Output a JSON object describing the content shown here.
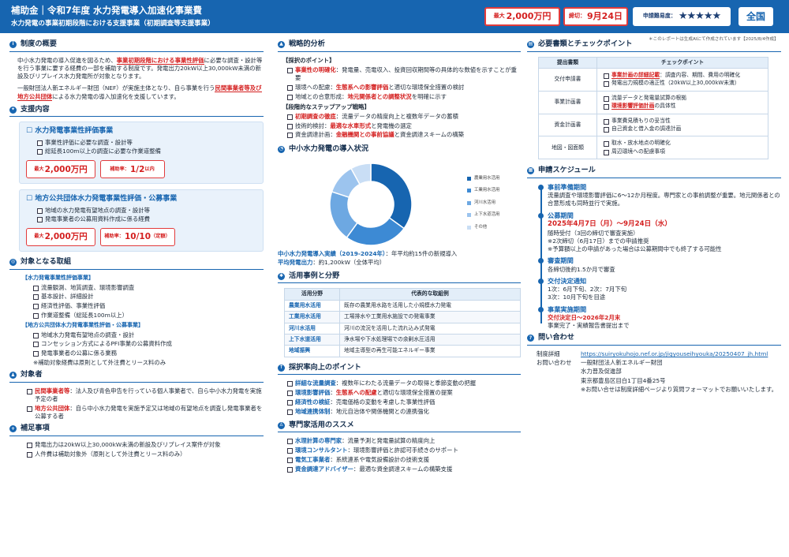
{
  "header": {
    "title": "補助金｜令和7年度 水力発電導入加速化事業費",
    "subtitle": "水力発電の事業初期段階における支援事業（初期調査等支援事業）",
    "max_amount_prefix": "最大",
    "max_amount": "2,000万円",
    "deadline_prefix": "締切：",
    "deadline": "9月24日",
    "difficulty_label": "申請難易度：",
    "difficulty_stars": "★★★★★",
    "region": "全国"
  },
  "ai_note": "＊このレポートは生成AIにて作成されています【2025/8/4作成】",
  "overview": {
    "title": "制度の概要",
    "p1a": "中小水力発電の導入促進を図るため、",
    "p1b": "事業初期段階における事業性評価",
    "p1c": "に必要な調査・設計等を行う事業に要する経費の一部を補助する制度です。発電出力20kW以上30,000kW未満の新設及びリプレイス水力発電所が対象となります。",
    "p2a": "一般財団法人新エネルギー財団（NEF）が実施主体となり、自ら事業を行う",
    "p2b": "民間事業者等及び地方公共団体",
    "p2c": "による水力発電の導入加速化を支援しています。"
  },
  "support": {
    "title": "支援内容",
    "box1": {
      "title": "水力発電事業性評価事業",
      "items": [
        "事業性評価に必要な調査・設計等",
        "総延長100m以上の調査に必要な作業道整備"
      ],
      "amount_prefix": "最大",
      "amount": "2,000万円",
      "rate_prefix": "補助率：",
      "rate": "1/2",
      "rate_suffix": "以内"
    },
    "box2": {
      "title": "地方公共団体水力発電事業性評価・公募事業",
      "items": [
        "地域の水力発電有望地点の調査・設計等",
        "発電事業者の公募用資料作成に係る経費"
      ],
      "amount_prefix": "最大",
      "amount": "2,000万円",
      "rate_prefix": "補助率：",
      "rate": "10/10",
      "rate_suffix": "（定額）"
    }
  },
  "targets_work": {
    "title": "対象となる取組",
    "g1": "【水力発電事業性評価事業】",
    "g1_items": [
      "流量観測、地質調査、環境影響調査",
      "基本設計、詳細設計",
      "経済性評価、事業性評価",
      "作業道整備（総延長100m以上）"
    ],
    "g2": "【地方公共団体水力発電事業性評価・公募事業】",
    "g2_items": [
      "地域水力発電有望地点の調査・設計",
      "コンセッション方式によるPFI事業の公募資料作成",
      "発電事業者の公募に係る業務"
    ],
    "note": "※補助対象経費は原則として外注費とリース料のみ"
  },
  "eligible": {
    "title": "対象者",
    "i1_key": "民間事業者等",
    "i1_text": "：法人及び青色申告を行っている個人事業者で、自ら中小水力発電を実施予定の者",
    "i2_key": "地方公共団体",
    "i2_text": "：自ら中小水力発電を実施予定又は地域の有望地点を調査し発電事業者を公募する者"
  },
  "supplement": {
    "title": "補足事項",
    "items": [
      "発電出力は20kW以上30,000kW未満の新設及びリプレイス案件が対象",
      "人件費は補助対象外（原則として外注費とリース料のみ）"
    ]
  },
  "strategy": {
    "title": "戦略的分析",
    "h1": "【採択のポイント】",
    "p_items": [
      {
        "key": "事業性の明確化",
        "text": "：発電量、売電収入、投資回収期間等の具体的な数値を示すことが重要"
      },
      {
        "pre": "環境への配慮：",
        "key": "生態系への影響評価",
        "text": "と適切な環境保全措置の検討"
      },
      {
        "pre": "地域との合意形成：",
        "key": "地元関係者との調整状況",
        "text": "を明確に示す"
      }
    ],
    "h2": "【段階的なステップアップ戦略】",
    "s_items": [
      {
        "key": "初期調査の徹底",
        "text": "：流量データの精度向上と複数年データの蓄積"
      },
      {
        "pre": "技術的検討：",
        "key": "最適な水車形式",
        "text": "と発電機の選定"
      },
      {
        "pre": "資金調達計画：",
        "key": "金融機関との事前協議",
        "text": "と資金調達スキームの構築"
      }
    ]
  },
  "adoption": {
    "title": "中小水力発電の導入状況",
    "line1_key": "中小水力発電導入実績（2019-2024年）",
    "line1_val": "：年平均約15件の新規導入",
    "line2_key": "平均発電出力",
    "line2_val": "：約1,200kW（全体平均）"
  },
  "chart_data": {
    "type": "pie",
    "labels": [
      "農業用水活用",
      "工業用水活用",
      "河川水活用",
      "上下水道活用",
      "その他"
    ],
    "values": [
      35,
      25,
      20,
      12,
      8
    ],
    "colors": [
      "#1765b0",
      "#3d8ad4",
      "#6da8e2",
      "#9cc4ee",
      "#c9def5"
    ]
  },
  "usecases": {
    "title": "活用事例と分野",
    "headers": [
      "活用分野",
      "代表的な取組例"
    ],
    "rows": [
      [
        "農業用水活用",
        "既存の農業用水路を活用した小規模水力発電"
      ],
      [
        "工業用水活用",
        "工場排水や工業用水施設での発電事業"
      ],
      [
        "河川水活用",
        "河川の流況を活用した流れ込み式発電"
      ],
      [
        "上下水道活用",
        "浄水場や下水処理場での余剰水圧活用"
      ],
      [
        "地域振興",
        "地域主導型の再生可能エネルギー事業"
      ]
    ]
  },
  "improve": {
    "title": "採択率向上のポイント",
    "items": [
      {
        "key": "詳細な流量調査",
        "text": "：複数年にわたる流量データの取得と季節変動の把握"
      },
      {
        "key": "環境影響評価",
        "text": "：",
        "key2": "生態系への配慮",
        "text2": "と適切な環境保全措置の提案"
      },
      {
        "key": "経済性の検証",
        "text": "：売電価格の変動を考慮した事業性評価"
      },
      {
        "key": "地域連携体制",
        "text": "：地元自治体や関係機関との連携強化"
      }
    ]
  },
  "experts": {
    "title": "専門家活用のススメ",
    "items": [
      {
        "key": "水理計算の専門家",
        "text": "：流量予測と発電量試算の精度向上"
      },
      {
        "key": "環境コンサルタント",
        "text": "：環境影響評価と許認可手続きのサポート"
      },
      {
        "key": "電気工事業者",
        "text": "：系統連系や電気設備設計の技術支援"
      },
      {
        "key": "資金調達アドバイザー",
        "text": "：最適な資金調達スキームの構築支援"
      }
    ]
  },
  "docs": {
    "title": "必要書類とチェックポイント",
    "headers": [
      "提出書類",
      "チェックポイント"
    ],
    "rows": [
      {
        "doc": "交付申請書",
        "checks": [
          {
            "key": "事業計画の詳細記載",
            "text": "：調査内容、期間、費用の明確化"
          },
          {
            "text": "発電出力規模の適正性（20kW以上30,000kW未満）"
          }
        ]
      },
      {
        "doc": "事業計画書",
        "checks": [
          {
            "text": "流量データと発電量試算の根拠"
          },
          {
            "key": "環境影響評価計画",
            "text": "の具体性"
          }
        ]
      },
      {
        "doc": "資金計画書",
        "checks": [
          {
            "text": "事業費見積もりの妥当性"
          },
          {
            "text": "自己資金と借入金の調達計画"
          }
        ]
      },
      {
        "doc": "地図・図面類",
        "checks": [
          {
            "text": "取水・放水地点の明確化"
          },
          {
            "text": "周辺環境への配慮事項"
          }
        ]
      }
    ]
  },
  "schedule": {
    "title": "申請スケジュール",
    "s1_head": "事前準備期間",
    "s1_text": "流量調査や環境影響評価に6～12か月程度。専門家との事前調整が重要。地元関係者との合意形成も同時並行で実施。",
    "s2_head": "公募期間",
    "s2_main": "2025年4月7日（月）～9月24日（水）",
    "s2_l1": "随時受付（3回の締切で審査実施）",
    "s2_l2": "※2次締切（6月17日）までの申請推奨",
    "s2_l3": "※予算額以上の申請があった場合は公募期間中でも終了する可能性",
    "s3_head": "審査期間",
    "s3_text": "各締切後約1.5か月で審査",
    "s4_head": "交付決定通知",
    "s4_l1": "1次：6月下旬、2次：7月下旬",
    "s4_l2": "3次：10月下旬を目途",
    "s5_head": "事業実施期間",
    "s5_red": "交付決定日～2026年2月末",
    "s5_text": "事業完了・実績報告書提出まで"
  },
  "contact": {
    "title": "問い合わせ",
    "l1": "制度詳細",
    "url": "https://suiryokuhojo.nef.or.jp/jigyouseihyouka/20250407_jh.html",
    "l2": "お問い合わせ",
    "org": "一般財団法人新エネルギー財団",
    "dept": "水力普及促進部",
    "addr": "東京都豊島区目白1丁目4番25号",
    "note": "※お問い合せは制度詳細ページより質問フォーマットでお願いいたします。"
  }
}
